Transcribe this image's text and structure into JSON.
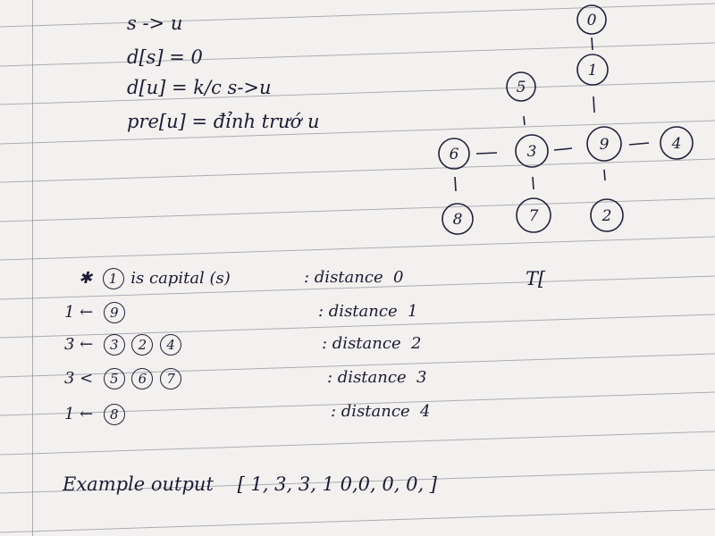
{
  "notes": {
    "line1": "s -> u",
    "line2": "d[s] = 0",
    "line3": "d[u] = k/c s->u",
    "line4": "pre[u] = đỉnh trướ u"
  },
  "graph": {
    "nodes": [
      "0",
      "1",
      "5",
      "6",
      "3",
      "9",
      "4",
      "8",
      "7",
      "2"
    ]
  },
  "bfs": {
    "row1": {
      "prefix": "",
      "circled": [
        "1"
      ],
      "text": "is  capital  (s)",
      "dist_label": ": distance",
      "dist": "0"
    },
    "row2": {
      "prefix": "1 ←",
      "circled": [
        "9"
      ],
      "dist_label": ": distance",
      "dist": "1"
    },
    "row3": {
      "prefix": "3 ←",
      "circled": [
        "3",
        "2",
        "4"
      ],
      "dist_label": ": distance",
      "dist": "2"
    },
    "row4": {
      "prefix": "3 <",
      "circled": [
        "5",
        "6",
        "7"
      ],
      "dist_label": ": distance",
      "dist": "3"
    },
    "row5": {
      "prefix": "1 ←",
      "circled": [
        "8"
      ],
      "dist_label": ": distance",
      "dist": "4"
    }
  },
  "tc": "T[",
  "example": {
    "label": "Example  output",
    "value": "[ 1, 3, 3, 1  0,0, 0, 0, ]"
  },
  "colors": {
    "ink": "#1d1a33",
    "paper": "#f3f1ef",
    "rule": "#8a8a96"
  }
}
